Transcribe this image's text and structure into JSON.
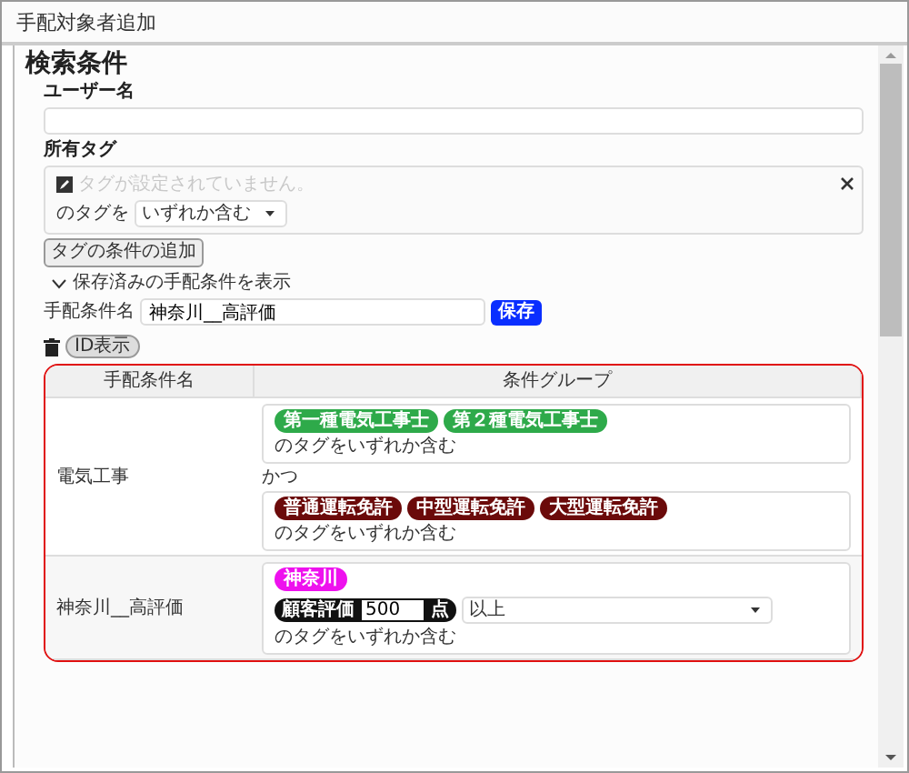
{
  "window": {
    "title": "手配対象者追加"
  },
  "heading": "検索条件",
  "user_name": {
    "label": "ユーザー名"
  },
  "owned_tags": {
    "label": "所有タグ",
    "placeholder": "タグが設定されていません。",
    "prefix": "のタグを",
    "match": "いずれか含む"
  },
  "add_tag_condition_button": "タグの条件の追加",
  "saved_toggle": {
    "label": "保存済みの手配条件を表示",
    "expanded": true
  },
  "condition_name": {
    "label": "手配条件名",
    "value": "神奈川__高評価",
    "save_button": "保存"
  },
  "id_toggle": "ID表示",
  "table": {
    "columns": [
      "手配条件名",
      "条件グループ"
    ],
    "rows": [
      {
        "name": "電気工事",
        "items": [
          {
            "kind": "group",
            "tags": [
              {
                "label": "第一種電気工事士",
                "color": "#2eaa4a"
              },
              {
                "label": "第２種電気工事士",
                "color": "#2eaa4a"
              }
            ],
            "text": "のタグをいずれか含む"
          },
          {
            "kind": "joiner",
            "text": "かつ"
          },
          {
            "kind": "group",
            "tags": [
              {
                "label": "普通運転免許",
                "color": "#6b0a0a"
              },
              {
                "label": "中型運転免許",
                "color": "#6b0a0a"
              },
              {
                "label": "大型運転免許",
                "color": "#6b0a0a"
              }
            ],
            "text": "のタグをいずれか含む"
          }
        ]
      },
      {
        "name": "神奈川__高評価",
        "items": [
          {
            "kind": "group",
            "tags": [
              {
                "label": "神奈川",
                "color": "#ee11ee"
              }
            ],
            "score": {
              "label": "顧客評価",
              "value": "500",
              "unit": "点",
              "comparator": "以上"
            },
            "text": "のタグをいずれか含む"
          }
        ]
      }
    ]
  }
}
